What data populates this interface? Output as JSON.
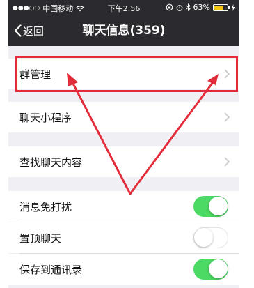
{
  "status_bar": {
    "signal_dots": "●●●○○",
    "carrier": "中国移动",
    "time": "下午2:56",
    "battery_percent": "63%"
  },
  "nav": {
    "back_label": "返回",
    "title": "聊天信息(359)"
  },
  "rows": {
    "group_manage": "群管理",
    "mini_programs": "聊天小程序",
    "search_content": "查找聊天内容",
    "mute": {
      "label": "消息免打扰",
      "on": true
    },
    "pin": {
      "label": "置顶聊天",
      "on": false
    },
    "save_contacts": {
      "label": "保存到通讯录",
      "on": true
    }
  },
  "colors": {
    "nav_bg": "#2b2b2f",
    "toggle_on": "#4cd964",
    "annotation_red": "#e32c3a"
  }
}
